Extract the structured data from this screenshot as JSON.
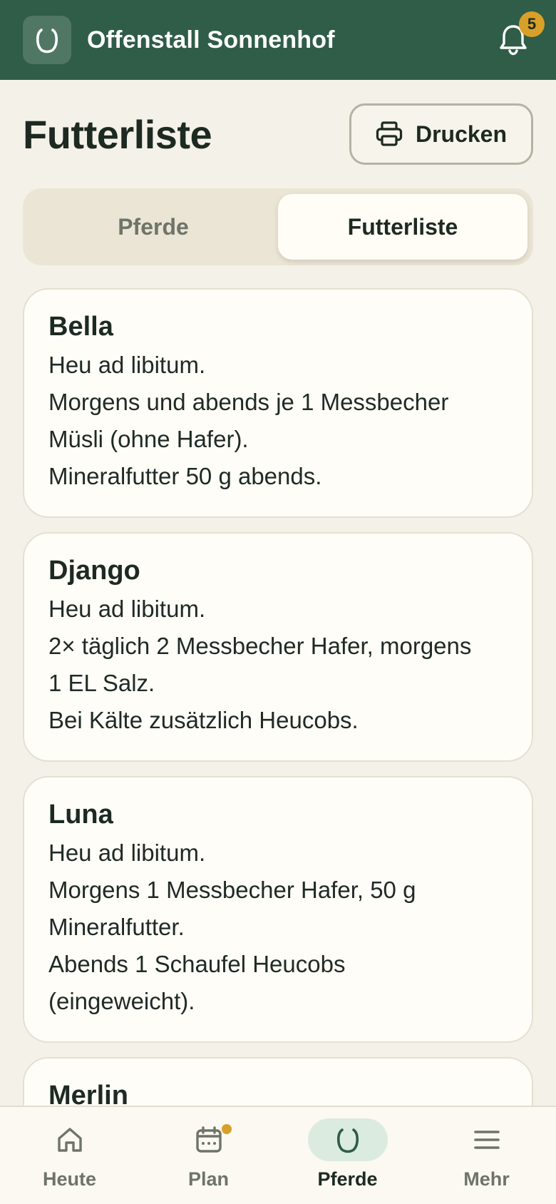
{
  "header": {
    "app_title": "Offenstall Sonnenhof",
    "logo_icon": "horseshoe-icon",
    "notification_count": "5",
    "colors": {
      "bar": "#2f5d47",
      "badge": "#d8a028"
    }
  },
  "page": {
    "title": "Futterliste",
    "print_label": "Drucken"
  },
  "segmented": {
    "tabs": [
      {
        "label": "Pferde",
        "active": false
      },
      {
        "label": "Futterliste",
        "active": true
      }
    ]
  },
  "feed_cards": [
    {
      "name": "Bella",
      "lines": [
        "Heu ad libitum.",
        "Morgens und abends je 1 Messbecher",
        "Müsli (ohne Hafer).",
        "Mineralfutter 50 g abends."
      ]
    },
    {
      "name": "Django",
      "lines": [
        "Heu ad libitum.",
        "2× täglich 2 Messbecher Hafer, morgens",
        "1 EL Salz.",
        "Bei Kälte zusätzlich Heucobs."
      ]
    },
    {
      "name": "Luna",
      "lines": [
        "Heu ad libitum.",
        "Morgens 1 Messbecher Hafer, 50 g",
        "Mineralfutter.",
        "Abends 1 Schaufel Heucobs",
        "(eingeweicht)."
      ]
    },
    {
      "name": "Merlin",
      "lines": []
    }
  ],
  "bottom_nav": [
    {
      "label": "Heute",
      "icon": "home-icon",
      "active": false
    },
    {
      "label": "Plan",
      "icon": "calendar-icon",
      "active": false,
      "has_dot": true
    },
    {
      "label": "Pferde",
      "icon": "horseshoe-icon",
      "active": true
    },
    {
      "label": "Mehr",
      "icon": "menu-icon",
      "active": false
    }
  ]
}
